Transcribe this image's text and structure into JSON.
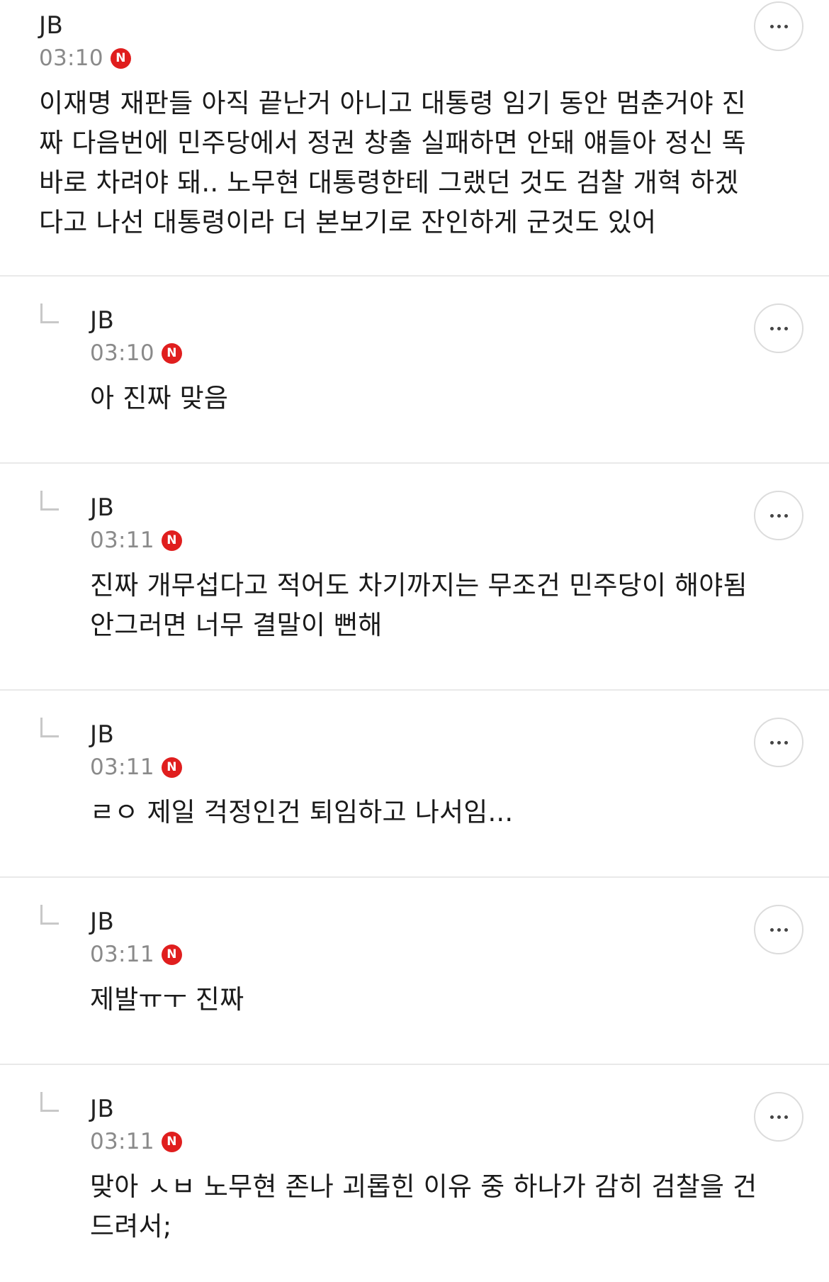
{
  "comments": [
    {
      "author": "JB",
      "time": "03:10",
      "badge": "N",
      "text": "이재명 재판들 아직 끝난거 아니고 대통령 임기 동안 멈춘거야 진짜 다음번에 민주당에서 정권 창출 실패하면 안돼 얘들아 정신 똑바로 차려야 돼.. 노무현 대통령한테 그랬던 것도 검찰 개혁 하겠다고 나선 대통령이라 더 본보기로 잔인하게 군것도 있어"
    },
    {
      "author": "JB",
      "time": "03:10",
      "badge": "N",
      "text": "아 진짜 맞음"
    },
    {
      "author": "JB",
      "time": "03:11",
      "badge": "N",
      "text": "진짜 개무섭다고 적어도 차기까지는 무조건 민주당이 해야됨 안그러면 너무 결말이 뻔해"
    },
    {
      "author": "JB",
      "time": "03:11",
      "badge": "N",
      "text": "ㄹㅇ 제일 걱정인건 퇴임하고 나서임..."
    },
    {
      "author": "JB",
      "time": "03:11",
      "badge": "N",
      "text": "제발ㅠㅜ 진짜"
    },
    {
      "author": "JB",
      "time": "03:11",
      "badge": "N",
      "text": "맞아 ㅅㅂ 노무현 존나 괴롭힌 이유 중 하나가 감히 검찰을 건드려서;"
    }
  ],
  "icons": {
    "reply": "reply-arrow-icon",
    "more": "more-options-icon",
    "new_badge": "new-badge-icon"
  },
  "colors": {
    "new_badge": "#e01e1e",
    "time": "#8a8a8a",
    "divider": "#e9e9e9"
  }
}
